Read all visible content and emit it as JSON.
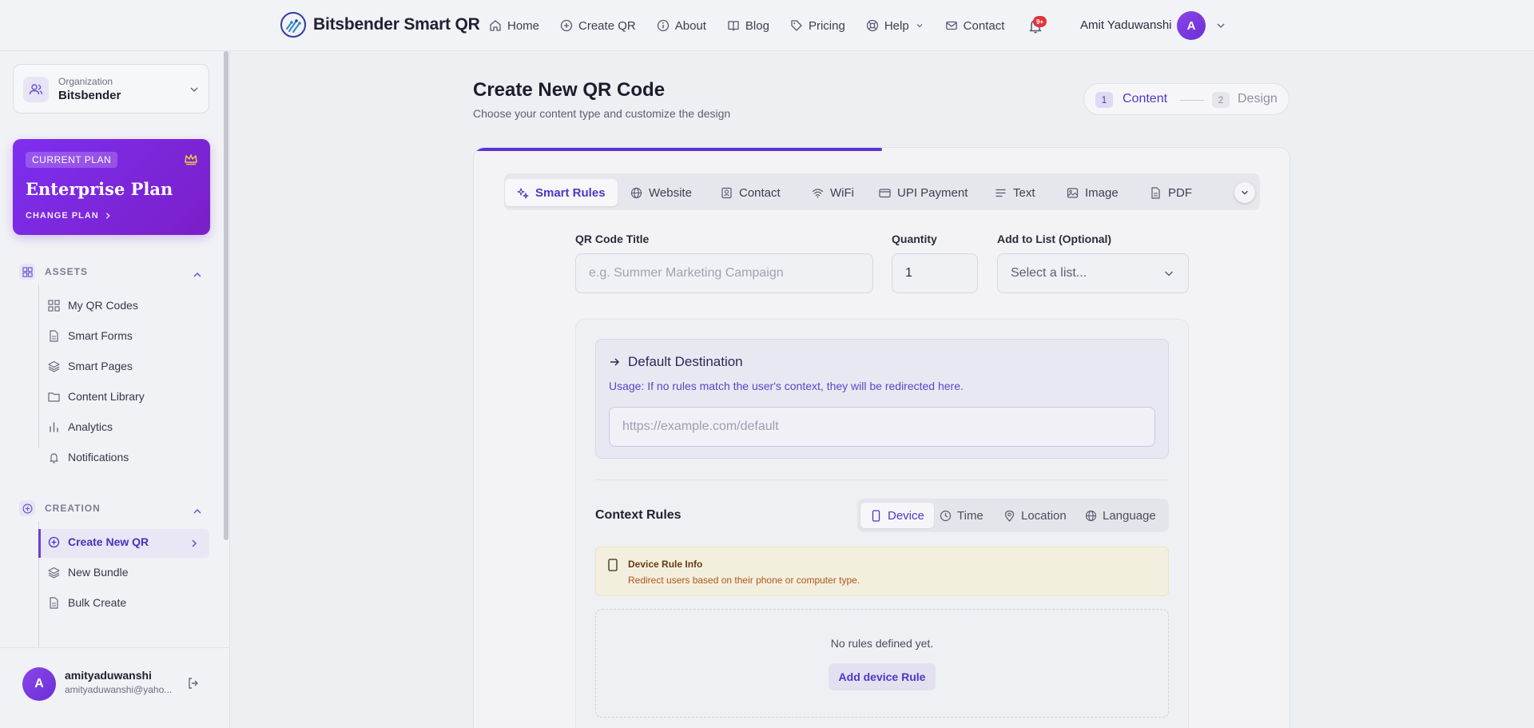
{
  "brand": {
    "name": "Bitsbender Smart QR"
  },
  "nav": {
    "items": [
      {
        "label": "Home",
        "icon": "home-icon"
      },
      {
        "label": "Create QR",
        "icon": "plus-circle-icon"
      },
      {
        "label": "About",
        "icon": "info-icon"
      },
      {
        "label": "Blog",
        "icon": "book-icon"
      },
      {
        "label": "Pricing",
        "icon": "tag-icon"
      },
      {
        "label": "Help",
        "icon": "lifebuoy-icon"
      },
      {
        "label": "Contact",
        "icon": "mail-icon"
      }
    ],
    "notification_badge": "9+",
    "user_name": "Amit Yaduwanshi",
    "avatar_initial": "A"
  },
  "sidebar": {
    "org_label": "Organization",
    "org_name": "Bitsbender",
    "plan": {
      "tag": "CURRENT PLAN",
      "name": "Enterprise Plan",
      "change": "CHANGE PLAN"
    },
    "assets": {
      "title": "ASSETS",
      "items": [
        "My QR Codes",
        "Smart Forms",
        "Smart Pages",
        "Content Library",
        "Analytics",
        "Notifications"
      ]
    },
    "creation": {
      "title": "CREATION",
      "items": [
        "Create New QR",
        "New Bundle",
        "Bulk Create"
      ]
    },
    "user": {
      "initial": "A",
      "name": "amityaduwanshi",
      "email": "amityaduwanshi@yaho..."
    }
  },
  "main": {
    "title": "Create New QR Code",
    "subtitle": "Choose your content type and customize the design",
    "stepper": {
      "step1_num": "1",
      "step1_label": "Content",
      "step2_num": "2",
      "step2_label": "Design"
    },
    "progress": 0.5,
    "type_tabs": [
      "Smart Rules",
      "Website",
      "Contact",
      "WiFi",
      "UPI Payment",
      "Text",
      "Image",
      "PDF"
    ],
    "fields": {
      "title_label": "QR Code Title",
      "title_placeholder": "e.g. Summer Marketing Campaign",
      "quantity_label": "Quantity",
      "quantity_value": "1",
      "list_label": "Add to List (Optional)",
      "list_placeholder": "Select a list..."
    },
    "default_destination": {
      "title": "Default Destination",
      "usage": "Usage: If no rules match the user's context, they will be redirected here.",
      "placeholder": "https://example.com/default"
    },
    "context_rules": {
      "title": "Context Rules",
      "tabs": [
        "Device",
        "Time",
        "Location",
        "Language"
      ],
      "info_title": "Device Rule Info",
      "info_text": "Redirect users based on their phone or computer type.",
      "empty_text": "No rules defined yet.",
      "add_button": "Add device Rule"
    }
  },
  "colors": {
    "accent": "#5935d4",
    "plan_gradient_start": "#7d2ff0",
    "plan_gradient_end": "#7a1fc7",
    "notification": "#e0353a"
  }
}
